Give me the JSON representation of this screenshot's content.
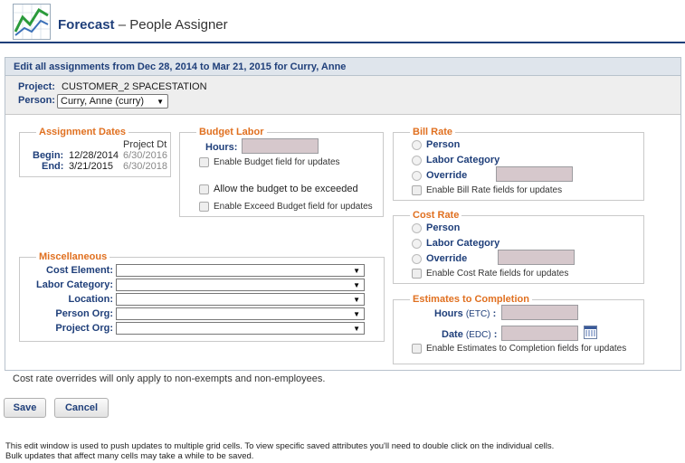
{
  "header": {
    "title": "Forecast",
    "separator": "–",
    "subtitle": "People Assigner"
  },
  "panel": {
    "heading": "Edit all assignments from Dec 28, 2014 to Mar 21, 2015 for Curry, Anne",
    "project_label": "Project:",
    "project_value": "CUSTOMER_2 SPACESTATION",
    "person_label": "Person:",
    "person_value": "Curry, Anne (curry)"
  },
  "assignment_dates": {
    "legend": "Assignment Dates",
    "col_header": "Project Dt",
    "begin_label": "Begin:",
    "begin_value": "12/28/2014",
    "begin_project": "6/30/2016",
    "end_label": "End:",
    "end_value": "3/21/2015",
    "end_project": "6/30/2018"
  },
  "budget_labor": {
    "legend": "Budget Labor",
    "hours_label": "Hours:",
    "hours_value": "",
    "enable_budget": "Enable Budget field for updates",
    "allow_exceed": "Allow the budget to be exceeded",
    "enable_exceed": "Enable Exceed Budget field for updates"
  },
  "bill_rate": {
    "legend": "Bill Rate",
    "opt_person": "Person",
    "opt_labor": "Labor Category",
    "opt_override": "Override",
    "enable": "Enable Bill Rate fields for updates"
  },
  "cost_rate": {
    "legend": "Cost Rate",
    "opt_person": "Person",
    "opt_labor": "Labor Category",
    "opt_override": "Override",
    "enable": "Enable Cost Rate fields for updates"
  },
  "misc": {
    "legend": "Miscellaneous",
    "cost_element": "Cost Element:",
    "labor_category": "Labor Category:",
    "location": "Location:",
    "person_org": "Person Org:",
    "project_org": "Project Org:"
  },
  "etc": {
    "legend": "Estimates to Completion",
    "hours_label": "Hours",
    "hours_unit": "(ETC)",
    "date_label": "Date",
    "date_unit": "(EDC)",
    "colon": ":",
    "enable": "Enable Estimates to Completion fields for updates"
  },
  "note": "Cost rate overrides will only apply to non-exempts and non-employees.",
  "buttons": {
    "save": "Save",
    "cancel": "Cancel"
  },
  "footer": {
    "line1": "This edit window is used to push updates to multiple grid cells. To view specific saved attributes you'll need to double click on the individual cells.",
    "line2": "Bulk updates that affect many cells may take a while to be saved."
  },
  "colors": {
    "brand": "#1f3f7a",
    "legend": "#e07020",
    "input_bg": "#d6c8cc"
  }
}
